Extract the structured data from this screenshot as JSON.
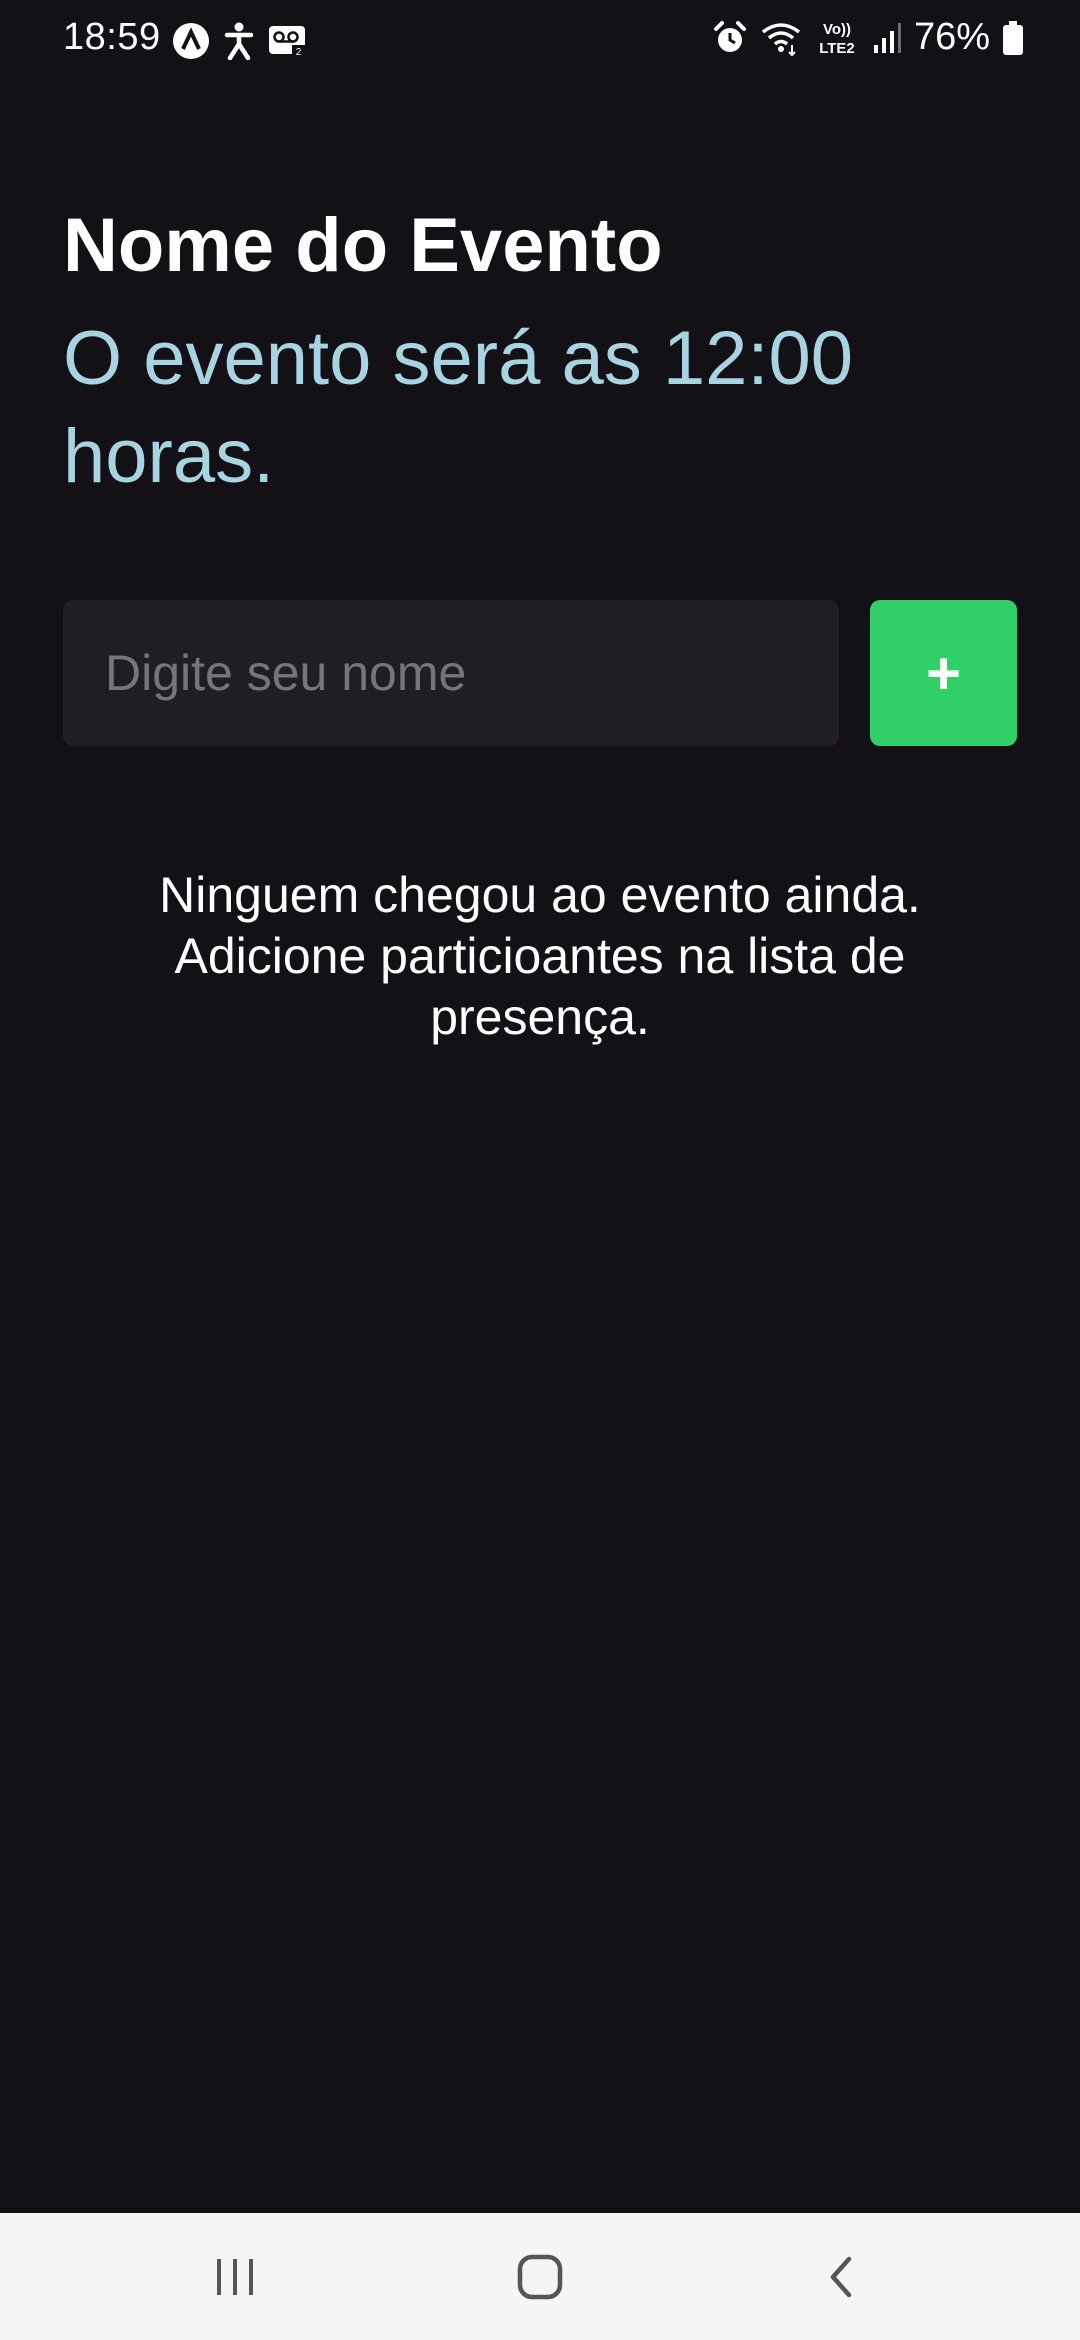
{
  "status_bar": {
    "time": "18:59",
    "battery": "76%",
    "icons_left": [
      "app-notification-icon",
      "accessibility-icon",
      "voicemail-icon"
    ],
    "icons_right": [
      "alarm-icon",
      "wifi-icon",
      "volte-icon",
      "signal-icon",
      "battery-icon"
    ],
    "volte_label_top": "Vo))",
    "volte_label_bottom": "LTE2"
  },
  "header": {
    "title": "Nome do Evento",
    "subtitle": "O evento será as 12:00 horas."
  },
  "form": {
    "input_placeholder": "Digite seu nome",
    "input_value": "",
    "add_button_label": "+"
  },
  "empty_state": {
    "message": "Ninguem chegou ao evento ainda. Adicione particioantes na lista de presença."
  },
  "nav_bar": {
    "buttons": [
      "recents",
      "home",
      "back"
    ]
  },
  "colors": {
    "background": "#131016",
    "subtitle": "#a8d3e0",
    "input_background": "#1f1e25",
    "accent": "#31cf67",
    "nav_background": "#f5f5f5"
  }
}
